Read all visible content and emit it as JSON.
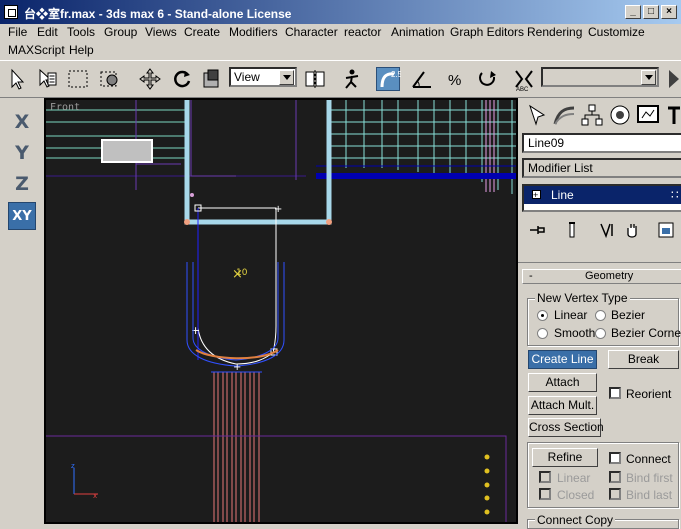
{
  "window": {
    "title": "台❖室fr.max - 3ds max 6 - Stand-alone License"
  },
  "menu": [
    "File",
    "Edit",
    "Tools",
    "Group",
    "Views",
    "Create",
    "Modifiers",
    "Character",
    "reactor",
    "Animation",
    "Graph Editors",
    "Rendering",
    "Customize",
    "MAXScript",
    "Help"
  ],
  "toolbar": {
    "ref_coord": "View",
    "named_selection": ""
  },
  "axis_buttons": [
    "X",
    "Y",
    "Z",
    "XY"
  ],
  "viewport": {
    "label": "Front",
    "colors": {
      "background": "#1c1c1c",
      "frame": "#a8d8ea",
      "geometry": "#0000c0",
      "selection": "#ffffff",
      "lines_red": "#e87878",
      "lines_cyan": "#88e0d8"
    }
  },
  "panel": {
    "object_name": "Line09",
    "modifier_list": "Modifier List",
    "stack_item": "Line",
    "rollout_minus": "-",
    "rollout_title": "Geometry",
    "vertex_group": "New Vertex Type",
    "vertex_types": {
      "linear": "Linear",
      "bezier": "Bezier",
      "smooth": "Smooth",
      "bezier_corner": "Bezier Corner"
    },
    "buttons": {
      "create_line": "Create Line",
      "break": "Break",
      "attach": "Attach",
      "attach_mult": "Attach Mult.",
      "cross_section": "Cross Section",
      "refine": "Refine"
    },
    "checkboxes": {
      "reorient": "Reorient",
      "connect": "Connect",
      "linear": "Linear",
      "bind_first": "Bind first",
      "closed": "Closed",
      "bind_last": "Bind last"
    },
    "connect_copy": "Connect Copy"
  }
}
